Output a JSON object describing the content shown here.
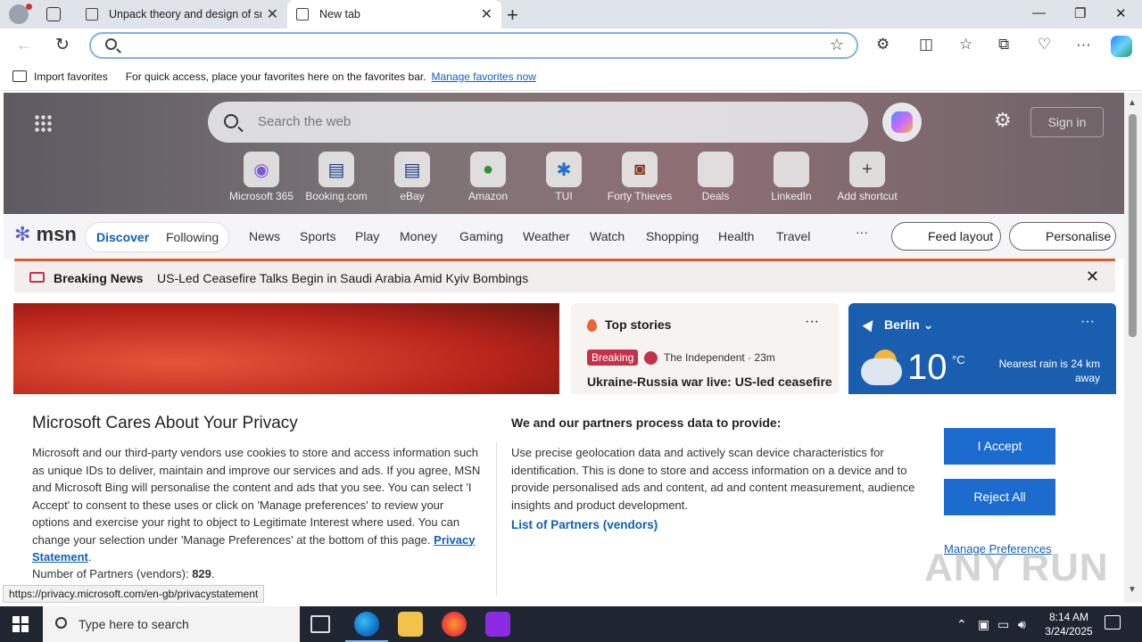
{
  "browser": {
    "tabs": [
      {
        "title": "Unpack theory and design of sm"
      },
      {
        "title": "New tab"
      }
    ],
    "address_placeholder": "",
    "favorites_bar": {
      "import_label": "Import favorites",
      "hint": "For quick access, place your favorites here on the favorites bar.",
      "manage_link": "Manage favorites now"
    },
    "status_url": "https://privacy.microsoft.com/en-gb/privacystatement"
  },
  "newtab": {
    "search_placeholder": "Search the web",
    "sign_in": "Sign in",
    "shortcuts": [
      {
        "label": "Microsoft 365",
        "icon": "m365-icon"
      },
      {
        "label": "Booking.com",
        "icon": "booking-icon"
      },
      {
        "label": "eBay",
        "icon": "ebay-icon"
      },
      {
        "label": "Amazon",
        "icon": "amazon-icon"
      },
      {
        "label": "TUI",
        "icon": "tui-icon"
      },
      {
        "label": "Forty Thieves",
        "icon": "forty-thieves-icon"
      },
      {
        "label": "Deals",
        "icon": "deals-icon"
      },
      {
        "label": "LinkedIn",
        "icon": "linkedin-icon"
      },
      {
        "label": "Add shortcut",
        "icon": "plus-icon"
      }
    ],
    "msn": {
      "logo": "msn",
      "discover": "Discover",
      "following": "Following",
      "nav": [
        "News",
        "Sports",
        "Play",
        "Money",
        "Gaming",
        "Weather",
        "Watch",
        "Shopping",
        "Health",
        "Travel"
      ],
      "more": "···",
      "feed_layout": "Feed layout",
      "personalise": "Personalise"
    },
    "breaking": {
      "label": "Breaking News",
      "text": "US-Led Ceasefire Talks Begin in Saudi Arabia Amid Kyiv Bombings"
    },
    "top_stories": {
      "title": "Top stories",
      "badge": "Breaking",
      "source": "The Independent · 23m",
      "headline": "Ukraine-Russia war live: US-led ceasefire"
    },
    "weather": {
      "location": "Berlin",
      "temp": "10",
      "unit": "°C",
      "rain_line1": "Nearest rain is 24 km",
      "rain_line2": "away"
    }
  },
  "privacy": {
    "title": "Microsoft Cares About Your Privacy",
    "body": "Microsoft and our third-party vendors use cookies to store and access information such as unique IDs to deliver, maintain and improve our services and ads. If you agree, MSN and Microsoft Bing will personalise the content and ads that you see. You can select 'I Accept' to consent to these uses or click on 'Manage preferences' to review your options and exercise your right to object to Legitimate Interest where used.  You can change your selection under 'Manage Preferences' at the bottom of this page.",
    "privacy_link": "Privacy Statement",
    "partners_count_label": "Number of Partners (vendors):",
    "partners_count": "829",
    "subtitle": "We and our partners process data to provide:",
    "body2": "Use precise geolocation data and actively scan device characteristics for identification. This is done to store and access information on a device and to provide personalised ads and content, ad and content measurement, audience insights and product development.",
    "partners_link": "List of Partners (vendors)",
    "accept": "I Accept",
    "reject": "Reject All",
    "manage": "Manage Preferences"
  },
  "watermark": "ANY RUN",
  "taskbar": {
    "search_placeholder": "Type here to search",
    "time": "8:14 AM",
    "date": "3/24/2025"
  }
}
